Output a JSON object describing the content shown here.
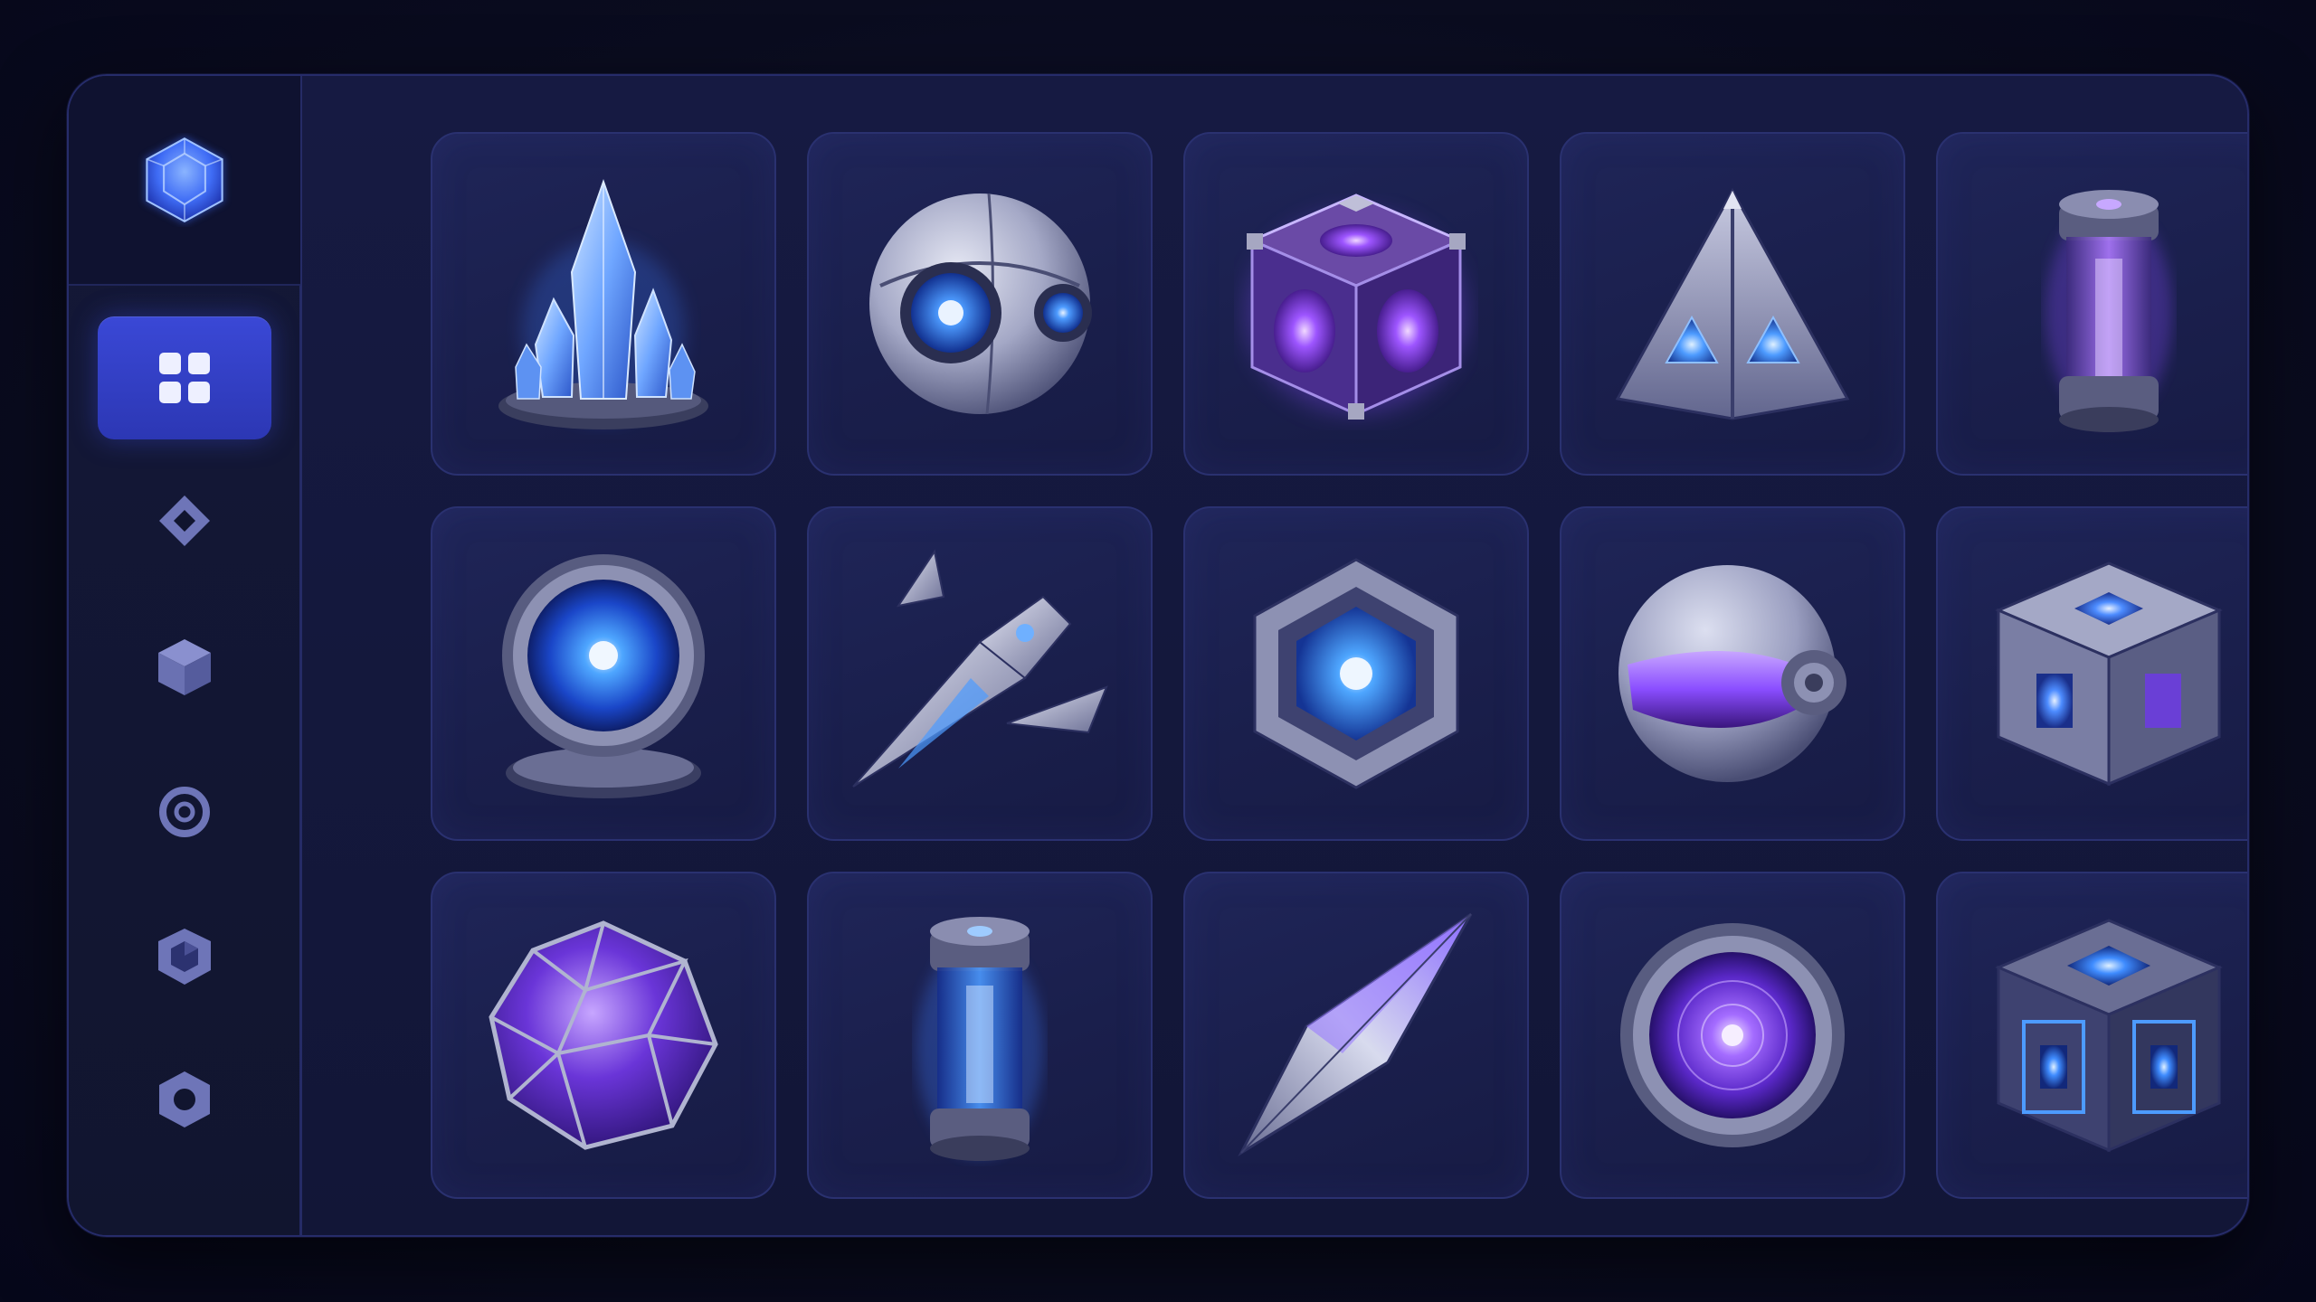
{
  "app": {
    "logo_icon": "hex-gem-icon",
    "accent": "#3a48d6",
    "glow_blue": "#4a8cff",
    "glow_violet": "#8a4dff"
  },
  "sidebar": {
    "items": [
      {
        "icon": "grid-icon",
        "active": true
      },
      {
        "icon": "diamond-outline-icon",
        "active": false
      },
      {
        "icon": "cube-icon",
        "active": false
      },
      {
        "icon": "ring-icon",
        "active": false
      },
      {
        "icon": "shield-icon",
        "active": false
      },
      {
        "icon": "hexagon-outline-icon",
        "active": false
      }
    ]
  },
  "assets": [
    {
      "icon": "ice-crystal-icon",
      "glow": "blue"
    },
    {
      "icon": "robot-sphere-icon",
      "glow": "blue"
    },
    {
      "icon": "energy-cube-icon",
      "glow": "violet"
    },
    {
      "icon": "pyramid-icon",
      "glow": "blue"
    },
    {
      "icon": "energy-canister-icon",
      "glow": "violet"
    },
    {
      "icon": "portal-disc-icon",
      "glow": "blue"
    },
    {
      "icon": "starship-icon",
      "glow": "blue"
    },
    {
      "icon": "hex-core-icon",
      "glow": "blue"
    },
    {
      "icon": "visor-helmet-icon",
      "glow": "violet"
    },
    {
      "icon": "metal-crate-icon",
      "glow": "blue"
    },
    {
      "icon": "crystal-sphere-icon",
      "glow": "violet"
    },
    {
      "icon": "plasma-canister-icon",
      "glow": "blue"
    },
    {
      "icon": "crystal-blade-icon",
      "glow": "violet"
    },
    {
      "icon": "vortex-disc-icon",
      "glow": "violet"
    },
    {
      "icon": "circuit-cube-icon",
      "glow": "blue"
    }
  ]
}
